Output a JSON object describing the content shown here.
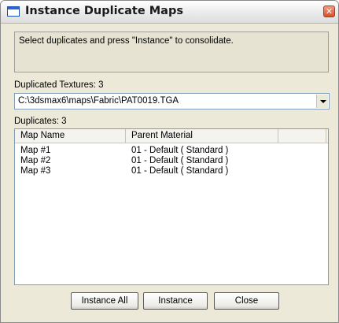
{
  "window": {
    "title": "Instance Duplicate Maps"
  },
  "info": {
    "text": "Select duplicates and press \"Instance\" to consolidate."
  },
  "duplicated_textures": {
    "label": "Duplicated Textures: 3",
    "selected_value": "C:\\3dsmax6\\maps\\Fabric\\PAT0019.TGA"
  },
  "duplicates": {
    "label": "Duplicates: 3",
    "columns": [
      "Map Name",
      "Parent Material",
      ""
    ],
    "rows": [
      {
        "map_name": "Map #1",
        "parent_material": "01 - Default  ( Standard )"
      },
      {
        "map_name": "Map #2",
        "parent_material": "01 - Default  ( Standard )"
      },
      {
        "map_name": "Map #3",
        "parent_material": "01 - Default  ( Standard )"
      }
    ]
  },
  "buttons": {
    "instance_all": "Instance All",
    "instance": "Instance",
    "close": "Close"
  },
  "icons": {
    "window_icon": "window-icon",
    "close_icon": "close-icon",
    "dropdown_icon": "chevron-down-icon"
  },
  "colors": {
    "dialog_bg": "#ece9d8",
    "list_bg": "#ffffff",
    "close_button": "#d9502a"
  }
}
